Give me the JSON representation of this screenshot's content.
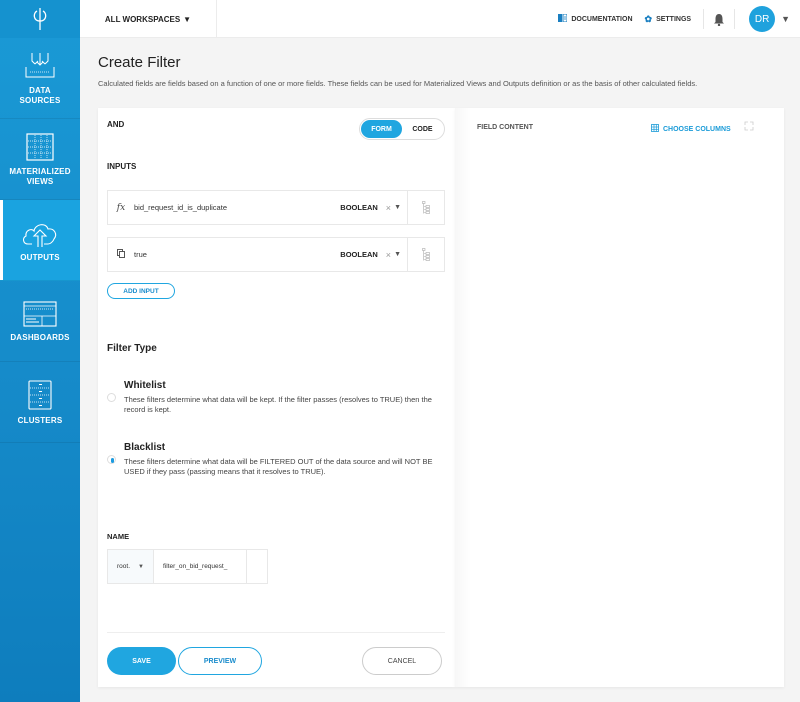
{
  "sidebar": {
    "logo": "φ",
    "items": [
      {
        "label_line1": "DATA",
        "label_line2": "SOURCES",
        "icon": "data-sources-icon",
        "active": false
      },
      {
        "label_line1": "MATERIALIZED",
        "label_line2": "VIEWS",
        "icon": "materialized-views-icon",
        "active": false
      },
      {
        "label_line1": "OUTPUTS",
        "label_line2": "",
        "icon": "cloud-upload-icon",
        "active": true
      },
      {
        "label_line1": "DASHBOARDS",
        "label_line2": "",
        "icon": "dashboard-icon",
        "active": false
      },
      {
        "label_line1": "CLUSTERS",
        "label_line2": "",
        "icon": "server-icon",
        "active": false
      }
    ]
  },
  "header": {
    "workspace": "ALL WORKSPACES",
    "documentation": "DOCUMENTATION",
    "settings": "SETTINGS",
    "avatar_initials": "DR"
  },
  "page": {
    "title": "Create Filter",
    "description": "Calculated fields are fields based on a function of one or more fields. These fields can be used for Materialized Views and Outputs definition or as the basis of other calculated fields."
  },
  "form": {
    "operator": "AND",
    "mode_toggle": {
      "form": "FORM",
      "code": "CODE",
      "selected": "FORM"
    },
    "inputs_label": "INPUTS",
    "inputs": [
      {
        "icon": "function-icon",
        "icon_glyph": "fx",
        "value": "bid_request_id_is_duplicate",
        "type": "BOOLEAN"
      },
      {
        "icon": "copy-icon",
        "icon_glyph": "⧉",
        "value": "true",
        "type": "BOOLEAN"
      }
    ],
    "add_input": "ADD INPUT",
    "filter_type_label": "Filter Type",
    "filter_types": [
      {
        "title": "Whitelist",
        "description": "These filters determine what data will be kept. If the filter passes (resolves to TRUE) then the record is kept.",
        "selected": false
      },
      {
        "title": "Blacklist",
        "description": "These filters determine what data will be FILTERED OUT of the data source and will NOT BE USED if they pass (passing means that it resolves to TRUE).",
        "selected": true
      }
    ],
    "name_label": "NAME",
    "namespace": "root.",
    "name_value": "filter_on_bid_request_",
    "buttons": {
      "save": "SAVE",
      "preview": "PREVIEW",
      "cancel": "CANCEL"
    }
  },
  "right_panel": {
    "field_content": "FIELD CONTENT",
    "choose_columns": "CHOOSE COLUMNS"
  }
}
